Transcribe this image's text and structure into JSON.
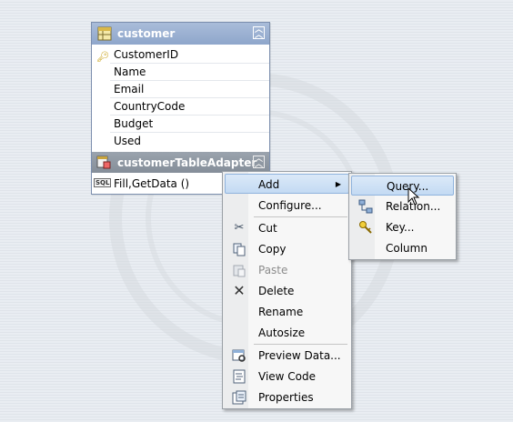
{
  "table": {
    "name": "customer",
    "columns": [
      {
        "name": "CustomerID",
        "primary_key": true
      },
      {
        "name": "Name",
        "primary_key": false
      },
      {
        "name": "Email",
        "primary_key": false
      },
      {
        "name": "CountryCode",
        "primary_key": false
      },
      {
        "name": "Budget",
        "primary_key": false
      },
      {
        "name": "Used",
        "primary_key": false
      }
    ],
    "adapter": {
      "name": "customerTableAdapter",
      "method": "Fill,GetData ()",
      "method_icon_text": "SQL"
    }
  },
  "context_menu": {
    "items": [
      {
        "label": "Add",
        "icon": "none",
        "submenu": true
      },
      {
        "label": "Configure...",
        "icon": "none"
      },
      {
        "label": "Cut",
        "icon": "scissors-icon"
      },
      {
        "label": "Copy",
        "icon": "copy-icon"
      },
      {
        "label": "Paste",
        "icon": "paste-icon",
        "disabled": true
      },
      {
        "label": "Delete",
        "icon": "delete-x-icon"
      },
      {
        "label": "Rename",
        "icon": "none"
      },
      {
        "label": "Autosize",
        "icon": "none"
      },
      {
        "label": "Preview Data...",
        "icon": "preview-data-icon"
      },
      {
        "label": "View Code",
        "icon": "view-code-icon"
      },
      {
        "label": "Properties",
        "icon": "properties-icon"
      }
    ]
  },
  "add_submenu": {
    "items": [
      {
        "label": "Query...",
        "icon": "none",
        "highlighted": true
      },
      {
        "label": "Relation...",
        "icon": "relation-icon"
      },
      {
        "label": "Key...",
        "icon": "key-icon"
      },
      {
        "label": "Column",
        "icon": "none"
      }
    ]
  },
  "colors": {
    "table_header": "#8ea6cb",
    "adapter_header": "#858e99",
    "menu_highlight": "#c3daf3",
    "menu_highlight_border": "#8fb3dd"
  }
}
